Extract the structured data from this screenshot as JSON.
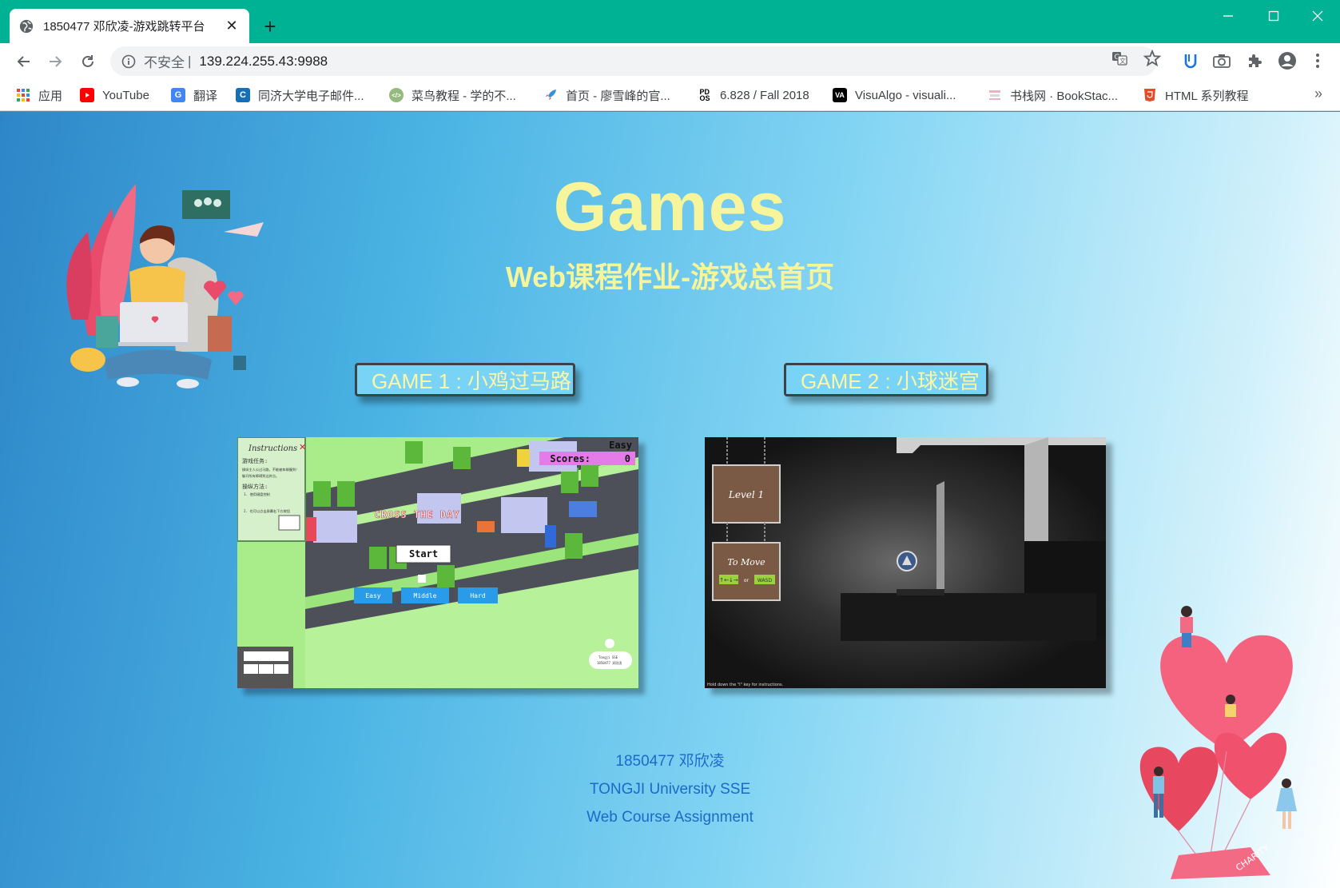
{
  "browser": {
    "tab_title": "1850477 邓欣凌-游戏跳转平台",
    "insecure_label": "不安全",
    "url_separator": "|",
    "url": "139.224.255.43:9988"
  },
  "bookmarks": [
    {
      "label": "应用",
      "icon": "apps-grid-icon"
    },
    {
      "label": "YouTube",
      "icon": "youtube-icon",
      "color": "#ff0000"
    },
    {
      "label": "翻译",
      "icon": "translate-icon",
      "color": "#4285f4"
    },
    {
      "label": "同济大学电子邮件...",
      "icon": "mail-c-icon",
      "color": "#1570b8"
    },
    {
      "label": "菜鸟教程 - 学的不...",
      "icon": "runoob-icon",
      "color": "#96b97d"
    },
    {
      "label": "首页 - 廖雪峰的官...",
      "icon": "rocket-icon",
      "color": "#3a8fd9"
    },
    {
      "label": "6.828 / Fall 2018",
      "icon": "pdos-icon"
    },
    {
      "label": "VisuAlgo - visuali...",
      "icon": "visualgo-icon"
    },
    {
      "label": "书栈网 · BookStac...",
      "icon": "bookstack-icon",
      "color": "#e0a0b0"
    },
    {
      "label": "HTML 系列教程",
      "icon": "html5-icon",
      "color": "#e34c26"
    }
  ],
  "page": {
    "title": "Games",
    "subtitle": "Web课程作业-游戏总首页",
    "game1_label": "GAME 1 : 小鸡过马路",
    "game2_label": "GAME 2 : 小球迷宫",
    "footer": {
      "line1": "1850477 邓欣凌",
      "line2": "TONGJI University SSE",
      "line3": "Web Course Assignment"
    }
  },
  "game1_preview": {
    "instructions_title": "Instructions",
    "instructions_task": "游戏任务:",
    "instructions_line1": "操纵主人公过马路，不能被车辆撞到！",
    "instructions_line2": "躲开所有障碍到达终点。",
    "instructions_method": "操纵方法:",
    "instructions_step1": "1. 使用键盘控制",
    "instructions_step2": "2. 也可以点击屏幕右下方按钮",
    "difficulty": "Easy",
    "scores_label": "Scores:",
    "scores_value": "0",
    "banner": "CROSS THE DAY",
    "start": "Start",
    "easy": "Easy",
    "middle": "Middle",
    "hard": "Hard",
    "badge_line1": "Tongji SSE",
    "badge_line2": "1850477 邓欣凌"
  },
  "game2_preview": {
    "sign_level": "Level 1",
    "sign_move": "To Move",
    "keys_left": "↑←↓→",
    "keys_or": "or",
    "keys_right": "WASD",
    "hint": "Hold down the \"I\" key for instructions."
  },
  "colors": {
    "chrome_accent": "#00b294",
    "title_yellow": "#f6f59b",
    "button_blue": "#78d3f7",
    "footer_blue": "#1b6ac8"
  }
}
